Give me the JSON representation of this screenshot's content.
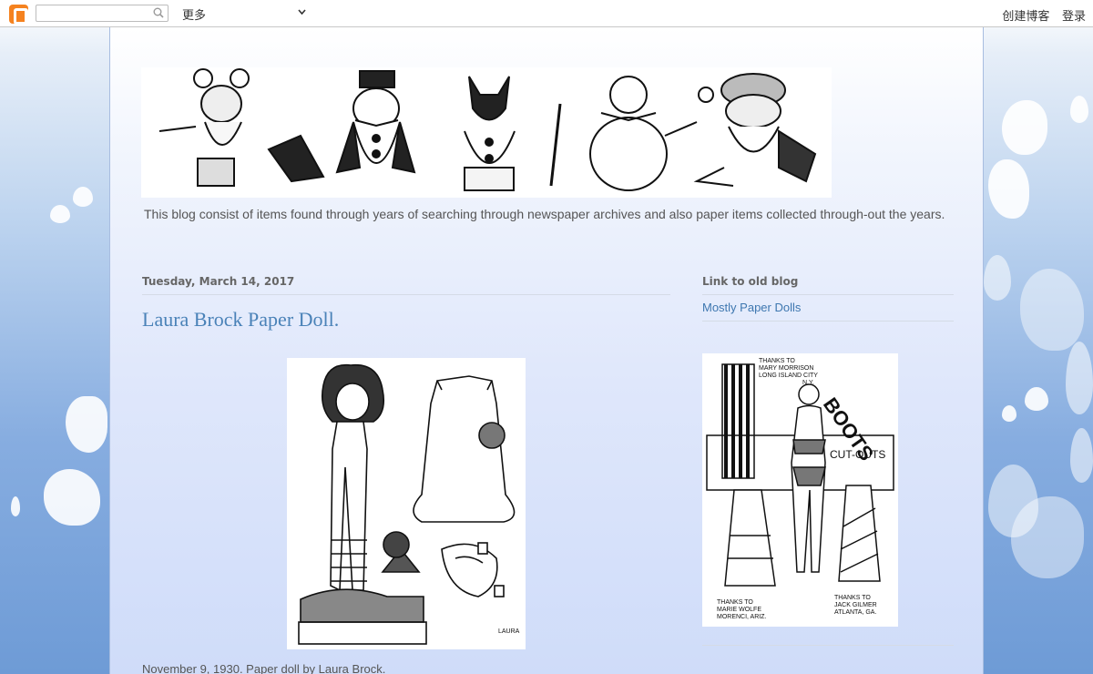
{
  "navbar": {
    "search_placeholder": "",
    "more_label": "更多",
    "create_blog_label": "创建博客",
    "login_label": "登录"
  },
  "blog": {
    "description": "This blog consist of items found through years of searching through newspaper archives and also paper items collected through-out the years."
  },
  "post": {
    "date": "Tuesday, March 14, 2017",
    "title": "Laura Brock Paper Doll.",
    "caption": "November 9, 1930.  Paper doll by Laura Brock."
  },
  "sidebar": {
    "widget_title": "Link to old blog",
    "link_label": "Mostly Paper Dolls",
    "image_text": {
      "thanks_top_1": "THANKS TO",
      "thanks_top_2": "MARY MORRISON",
      "thanks_top_3": "LONG ISLAND CITY",
      "thanks_top_4": "N.Y.",
      "boots": "BOOTS",
      "cutouts": "CUT-OUTS",
      "thanks_left_1": "THANKS TO",
      "thanks_left_2": "MARIE WOLFE",
      "thanks_left_3": "MORENCI, ARIZ.",
      "thanks_right_1": "THANKS TO",
      "thanks_right_2": "JACK GILMER",
      "thanks_right_3": "ATLANTA, GA."
    }
  },
  "colors": {
    "title_blue": "#4a82b8",
    "link_blue": "#3e77b0",
    "blogger_orange": "#f5821f"
  }
}
